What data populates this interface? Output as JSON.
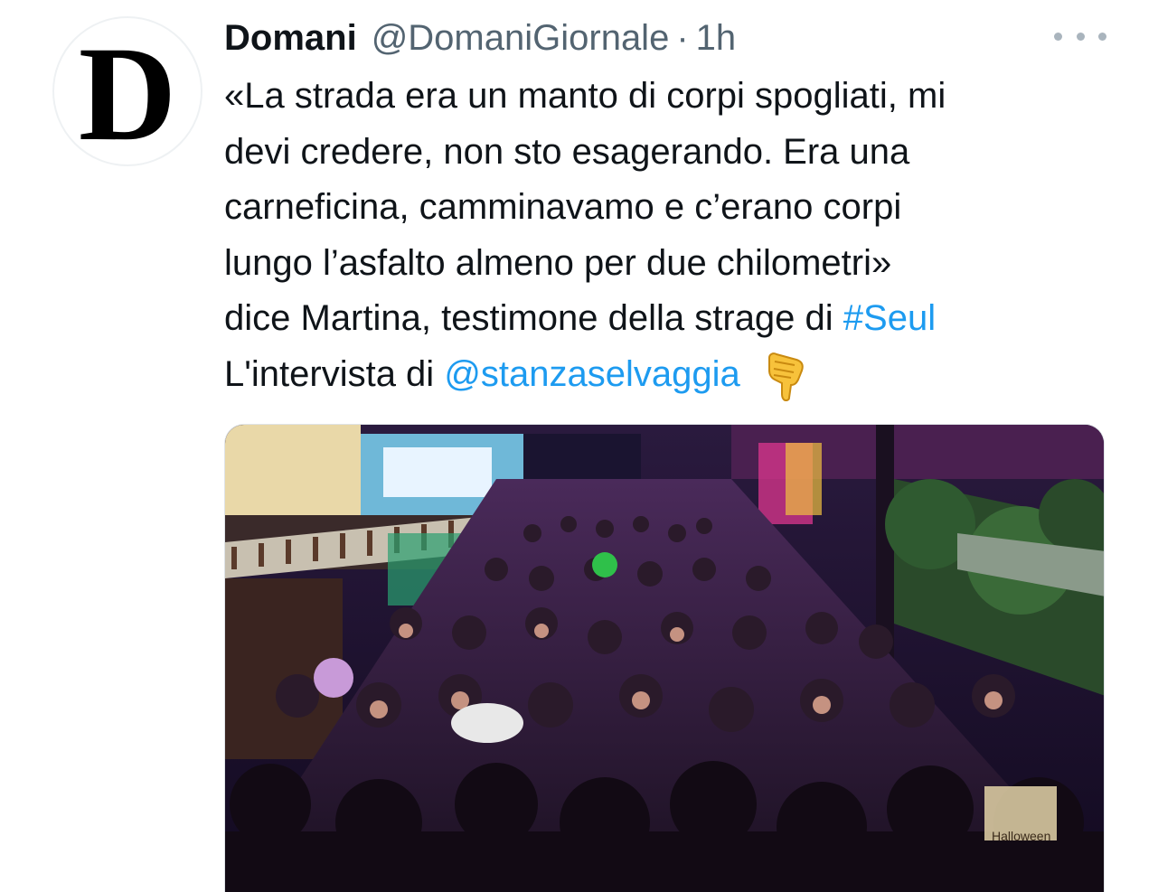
{
  "tweet": {
    "avatar_letter": "D",
    "display_name": "Domani",
    "handle": "@DomaniGiornale",
    "separator": "·",
    "time": "1h",
    "text_lines": [
      "«La strada era un manto di corpi spogliati, mi",
      "devi credere, non sto esagerando. Era una",
      "carneficina, camminavamo e c’erano corpi",
      "lungo l’asfalto almeno per due chilometri»"
    ],
    "line5_text": "dice Martina, testimone della strage di ",
    "hashtag": "#Seul",
    "line6_text": "L'intervista di ",
    "mention": "@stanzaselvaggia",
    "emoji": "backhand-index-pointing-down",
    "media": {
      "description_icon": "crowd-photo",
      "sign_text": "Halloween"
    }
  },
  "colors": {
    "text": "#0f1419",
    "secondary": "#536471",
    "link": "#1d9bf0",
    "more_dots": "#a9b4bd"
  }
}
